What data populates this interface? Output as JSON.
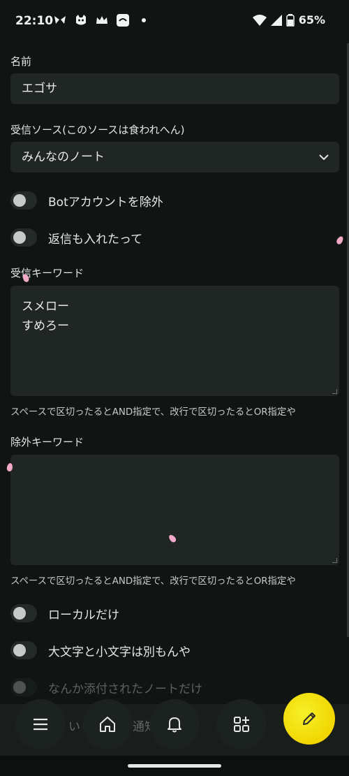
{
  "status": {
    "time": "22:10",
    "battery": "65%",
    "left_icons": [
      "butterfly-icon",
      "cat-face-icon",
      "crown-icon",
      "app-icon",
      "dot-icon"
    ]
  },
  "form": {
    "name_label": "名前",
    "name_value": "エゴサ",
    "source_label": "受信ソース(このソースは食われへん)",
    "source_value": "みんなのノート",
    "exclude_bots_label": "Botアカウントを除外",
    "include_replies_label": "返信も入れたって",
    "keywords_label": "受信キーワード",
    "keywords_line1": "スメロー",
    "keywords_line2": "すめろー",
    "keywords_hint": "スペースで区切ったるとAND指定で、改行で区切ったるとOR指定や",
    "exclude_keywords_label": "除外キーワード",
    "exclude_keywords_value": "",
    "exclude_keywords_hint": "スペースで区切ったるとAND指定で、改行で区切ったるとOR指定や",
    "local_only_label": "ローカルだけ",
    "case_sensitive_label": "大文字と小文字は別もんや",
    "with_file_label": "なんか添付されたノートだけ",
    "partial_text_1": "い",
    "partial_text_2": "通知"
  },
  "colors": {
    "background": "#101513",
    "input_bg": "#1f2624",
    "fab": "#f2d600"
  }
}
